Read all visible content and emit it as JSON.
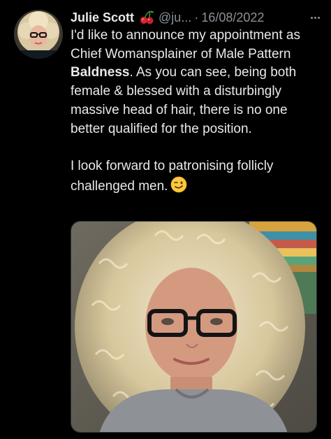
{
  "tweet": {
    "author_name": "Julie Scott",
    "name_emoji": "cherries-icon",
    "handle": "@ju...",
    "separator": "·",
    "date": "16/08/2022",
    "more_icon": "more-horizontal-icon",
    "body": {
      "line_1_prefix": "I'd like to announce my appointment as Chief Womansplainer of Male Pattern ",
      "line_1_bold": "Baldness",
      "line_1_suffix": ". As you can see, being both female & blessed with a disturbingly massive head of hair, there is no one better qualified for the position.",
      "line_2": "I look forward to patronising follicly challenged men.",
      "emoji": "winking-face-icon"
    },
    "media": {
      "kind": "photo",
      "subject": "woman-with-curly-blonde-hair-and-glasses"
    }
  },
  "colors": {
    "background": "#000000",
    "text_primary": "#e7e9ea",
    "text_secondary": "#8b9197",
    "border": "#2f3336"
  }
}
